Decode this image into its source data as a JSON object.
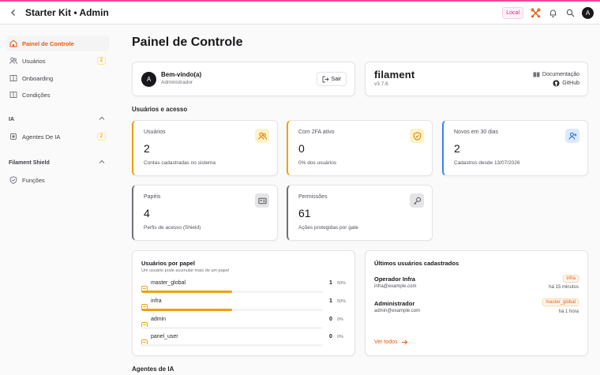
{
  "app": {
    "title": "Starter Kit • Admin",
    "env_badge": "Local",
    "avatar_initial": "A"
  },
  "sidebar": {
    "items": [
      {
        "label": "Painel de Controle",
        "icon": "home-icon",
        "active": true
      },
      {
        "label": "Usuários",
        "icon": "users-icon",
        "badge": "2"
      },
      {
        "label": "Onboarding",
        "icon": "book-icon"
      },
      {
        "label": "Condições",
        "icon": "book-icon"
      }
    ],
    "groups": [
      {
        "label": "IA",
        "items": [
          {
            "label": "Agentes De IA",
            "icon": "cpu-icon",
            "badge": "2"
          }
        ]
      },
      {
        "label": "Filament Shield",
        "items": [
          {
            "label": "Funções",
            "icon": "shield-icon"
          }
        ]
      }
    ]
  },
  "page": {
    "title": "Painel de Controle"
  },
  "welcome": {
    "avatar_initial": "A",
    "title": "Bem-vindo(a)",
    "role": "Administrador",
    "logout_label": "Sair"
  },
  "filament": {
    "logo": "filament",
    "version": "v3.7.6",
    "docs_label": "Documentação",
    "github_label": "GitHub"
  },
  "sections": {
    "users_access": "Usuários e acesso",
    "ai_agents": "Agentes de IA"
  },
  "stats": [
    {
      "label": "Usuários",
      "value": "2",
      "desc": "Contas cadastradas no sistema",
      "accent": "#f59e0b",
      "icon": "users-icon"
    },
    {
      "label": "Com 2FA ativo",
      "value": "0",
      "desc": "0% dos usuários",
      "accent": "#f59e0b",
      "icon": "shield-check-icon"
    },
    {
      "label": "Novos em 30 dias",
      "value": "2",
      "desc": "Cadastros desde 13/07/2026",
      "accent": "#3b82f6",
      "icon": "user-plus-icon"
    },
    {
      "label": "Papéis",
      "value": "4",
      "desc": "Perfis de acesso (Shield)",
      "accent": "#71717a",
      "icon": "id-card-icon"
    },
    {
      "label": "Permissões",
      "value": "61",
      "desc": "Ações protegidas por gate",
      "accent": "#71717a",
      "icon": "key-icon"
    }
  ],
  "roles": {
    "title": "Usuários por papel",
    "subtitle": "Um usuário pode acumular mais de um papel",
    "items": [
      {
        "name": "master_global",
        "count": "1",
        "pct": "50%",
        "fill": 0.5
      },
      {
        "name": "infra",
        "count": "1",
        "pct": "50%",
        "fill": 0.5
      },
      {
        "name": "admin",
        "count": "0",
        "pct": "0%",
        "fill": 0
      },
      {
        "name": "panel_user",
        "count": "0",
        "pct": "0%",
        "fill": 0
      }
    ]
  },
  "latest_users": {
    "title": "Últimos usuários cadastrados",
    "items": [
      {
        "name": "Operador Infra",
        "email": "infra@example.com",
        "badge": "infra",
        "time": "há 15 minutos"
      },
      {
        "name": "Administrador",
        "email": "admin@example.com",
        "badge": "master_global",
        "time": "há 1 hora"
      }
    ],
    "see_all": "Ver todos"
  }
}
